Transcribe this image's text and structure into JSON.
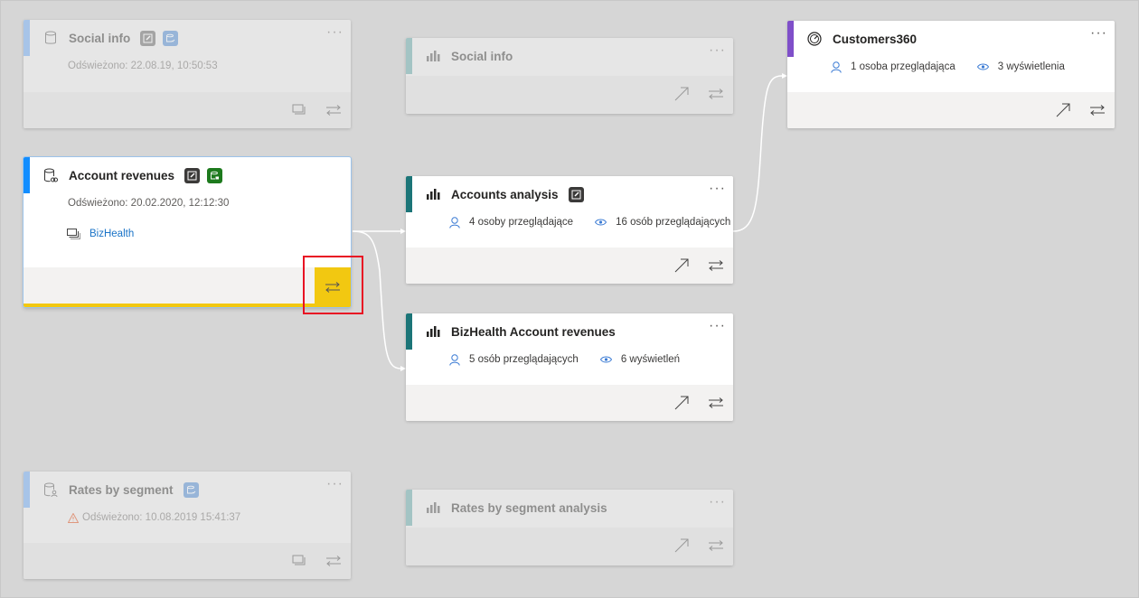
{
  "cards": {
    "social_info_dataset": {
      "title": "Social info",
      "refreshed": "Odświeżono: 22.08.19, 10:50:53",
      "icon": "database-icon",
      "badges": [
        "certified-icon",
        "database-check-icon"
      ],
      "accent_color": "#a7c4e8",
      "dimmed": true
    },
    "account_revenues": {
      "title": "Account revenues",
      "refreshed": "Odświeżono: 20.02.2020, 12:12:30",
      "workspace": "BizHealth",
      "icon": "database-linked-icon",
      "badges": [
        "certified-icon",
        "database-lock-icon"
      ],
      "accent_color": "#118dff",
      "selected": true,
      "highlight_color": "#f2c811"
    },
    "rates_by_segment": {
      "title": "Rates by segment",
      "refreshed": "Odświeżono: 10.08.2019 15:41:37",
      "icon": "database-user-icon",
      "badges": [
        "database-check-icon"
      ],
      "warning": true,
      "accent_color": "#a7c4e8",
      "dimmed": true
    },
    "social_info_report": {
      "title": "Social info",
      "icon": "bar-chart-icon",
      "accent_color": "#a3c4c4",
      "dimmed": true
    },
    "accounts_analysis": {
      "title": "Accounts analysis",
      "icon": "bar-chart-icon",
      "badges": [
        "certified-icon"
      ],
      "viewers": "4 osoby przeglądające",
      "views": "16 osób przeglądających",
      "accent_color": "#1c7578"
    },
    "bizhealth_account_revenues": {
      "title": "BizHealth Account revenues",
      "icon": "bar-chart-icon",
      "viewers": "5 osób przeglądających",
      "views": "6 wyświetleń",
      "accent_color": "#1c7578"
    },
    "rates_by_segment_analysis": {
      "title": "Rates by segment analysis",
      "icon": "bar-chart-icon",
      "accent_color": "#a3c4c4",
      "dimmed": true
    },
    "customers360": {
      "title": "Customers360",
      "icon": "dashboard-gauge-icon",
      "viewers": "1 osoba przeglądająca",
      "views": "3 wyświetlenia",
      "accent_color": "#7f4fc9"
    }
  },
  "more_label": "···",
  "colors": {
    "canvas": "#d6d6d6",
    "footer": "#f3f2f1",
    "stat_icon": "#3b7bd4",
    "link": "#1a73c7",
    "annotation_box": "#e81123"
  }
}
